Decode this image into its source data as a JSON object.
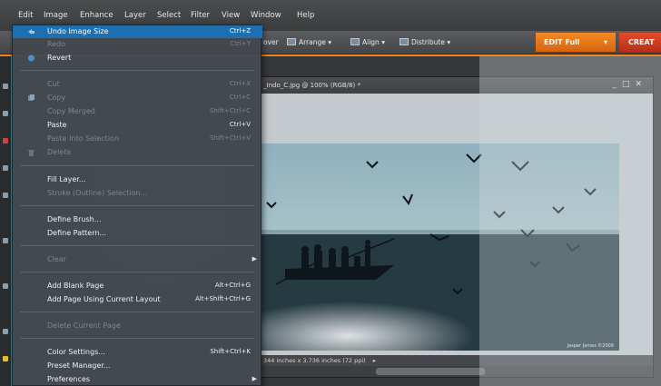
{
  "menubar": {
    "items": [
      "Edit",
      "Image",
      "Enhance",
      "Layer",
      "Select",
      "Filter",
      "View",
      "Window",
      "Help"
    ]
  },
  "toolbar": {
    "arrange": "Arrange",
    "align": "Align",
    "distribute": "Distribute",
    "cover_fragment": "over",
    "edit_full": "EDIT Full",
    "create": "CREAT"
  },
  "document": {
    "title": "_Indo_C.jpg @ 100% (RGB/8) *",
    "photo_credit": "Jasper James ©2009",
    "status": "344 inches x 3.736 inches (72 ppi)"
  },
  "edit_menu": {
    "items": [
      {
        "label": "Undo Image Size",
        "shortcut": "Ctrl+Z",
        "state": "highlighted"
      },
      {
        "label": "Redo",
        "shortcut": "Ctrl+Y",
        "state": "disabled"
      },
      {
        "label": "Revert",
        "shortcut": "",
        "state": "enabled"
      },
      {
        "label": "Cut",
        "shortcut": "Ctrl+X",
        "state": "disabled"
      },
      {
        "label": "Copy",
        "shortcut": "Ctrl+C",
        "state": "disabled"
      },
      {
        "label": "Copy Merged",
        "shortcut": "Shift+Ctrl+C",
        "state": "disabled"
      },
      {
        "label": "Paste",
        "shortcut": "Ctrl+V",
        "state": "enabled"
      },
      {
        "label": "Paste Into Selection",
        "shortcut": "Shift+Ctrl+V",
        "state": "disabled"
      },
      {
        "label": "Delete",
        "shortcut": "",
        "state": "disabled"
      },
      {
        "label": "Fill Layer...",
        "shortcut": "",
        "state": "enabled"
      },
      {
        "label": "Stroke (Outline) Selection...",
        "shortcut": "",
        "state": "disabled"
      },
      {
        "label": "Define Brush...",
        "shortcut": "",
        "state": "enabled"
      },
      {
        "label": "Define Pattern...",
        "shortcut": "",
        "state": "enabled"
      },
      {
        "label": "Clear",
        "shortcut": "",
        "state": "disabled"
      },
      {
        "label": "Add Blank Page",
        "shortcut": "Alt+Ctrl+G",
        "state": "enabled"
      },
      {
        "label": "Add Page Using Current Layout",
        "shortcut": "Alt+Shift+Ctrl+G",
        "state": "enabled"
      },
      {
        "label": "Delete Current Page",
        "shortcut": "",
        "state": "disabled"
      },
      {
        "label": "Color Settings...",
        "shortcut": "Shift+Ctrl+K",
        "state": "enabled"
      },
      {
        "label": "Preset Manager...",
        "shortcut": "",
        "state": "enabled"
      },
      {
        "label": "Preferences",
        "shortcut": "",
        "state": "enabled"
      }
    ]
  },
  "colors": {
    "accent_orange": "#f0871f",
    "create_red": "#d03a20",
    "menu_highlight": "#1e6fb0"
  }
}
